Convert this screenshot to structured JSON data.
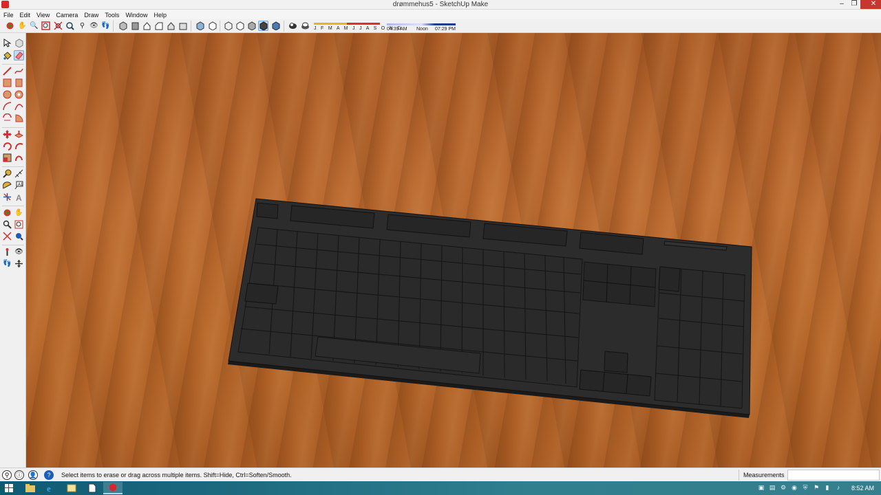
{
  "window": {
    "title": "drømmehus5 - SketchUp Make",
    "minimize": "–",
    "maximize": "❐",
    "close": "✕"
  },
  "menu": [
    "File",
    "Edit",
    "View",
    "Camera",
    "Draw",
    "Tools",
    "Window",
    "Help"
  ],
  "toolbar": {
    "shadow_months": "J F M A M J J A S O N D",
    "time_start": "04:39 AM",
    "time_mid": "Noon",
    "time_end": "07:29 PM",
    "active_tool": "x-ray-style"
  },
  "palette": {
    "active_tool": "eraser-tool"
  },
  "statusbar": {
    "hint": "Select items to erase or drag across multiple items. Shift=Hide, Ctrl=Soften/Smooth.",
    "measurements_label": "Measurements",
    "measurements_value": ""
  },
  "taskbar": {
    "time": "8:52 AM",
    "apps": [
      "file-explorer-icon",
      "internet-explorer-icon",
      "folder-icon",
      "document-icon",
      "sketchup-icon"
    ]
  },
  "colors": {
    "accent_active": "#c6d9ef",
    "wood": "#b46528",
    "keyboard": "#2c2c2c",
    "taskbar": "#2f7f8f"
  }
}
